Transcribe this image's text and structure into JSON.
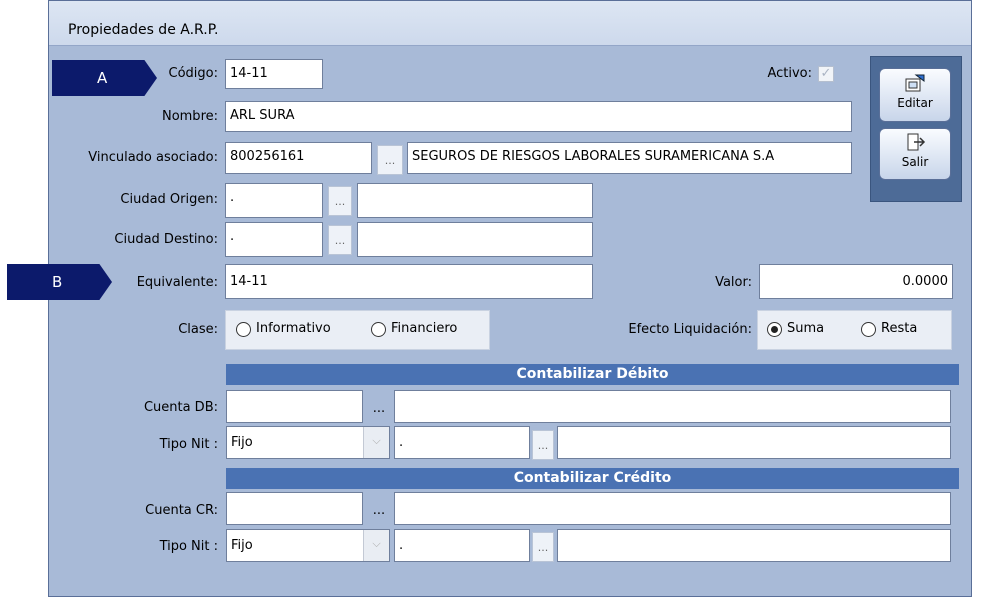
{
  "window": {
    "title": "Propiedades de A.R.P."
  },
  "callouts": {
    "a": "A",
    "b": "B"
  },
  "form": {
    "codigo": {
      "label": "Código:",
      "value": "14-11"
    },
    "activo": {
      "label": "Activo:",
      "checked": true
    },
    "nombre": {
      "label": "Nombre:",
      "value": "ARL SURA"
    },
    "vinculado": {
      "label": "Vinculado asociado:",
      "value": "800256161",
      "description": "SEGUROS DE RIESGOS LABORALES SURAMERICANA S.A"
    },
    "ciudad_origen": {
      "label": "Ciudad Origen:",
      "value": ".",
      "description": ""
    },
    "ciudad_destino": {
      "label": "Ciudad Destino:",
      "value": ".",
      "description": ""
    },
    "equivalente": {
      "label": "Equivalente:",
      "value": "14-11"
    },
    "valor": {
      "label": "Valor:",
      "value": "0.0000"
    },
    "clase": {
      "label": "Clase:",
      "options": [
        "Informativo",
        "Financiero"
      ],
      "selected": null
    },
    "efecto": {
      "label": "Efecto Liquidación:",
      "options": [
        "Suma",
        "Resta"
      ],
      "selected": "Suma"
    }
  },
  "debito": {
    "header": "Contabilizar Débito",
    "cuenta": {
      "label": "Cuenta DB:",
      "value": "",
      "description": ""
    },
    "tipo_nit": {
      "label": "Tipo Nit :",
      "value": "Fijo",
      "nit": ".",
      "description": ""
    }
  },
  "credito": {
    "header": "Contabilizar Crédito",
    "cuenta": {
      "label": "Cuenta CR:",
      "value": "",
      "description": ""
    },
    "tipo_nit": {
      "label": "Tipo Nit :",
      "value": "Fijo",
      "nit": ".",
      "description": ""
    }
  },
  "toolbar": {
    "editar": "Editar",
    "salir": "Salir"
  },
  "ellipsis": "..."
}
